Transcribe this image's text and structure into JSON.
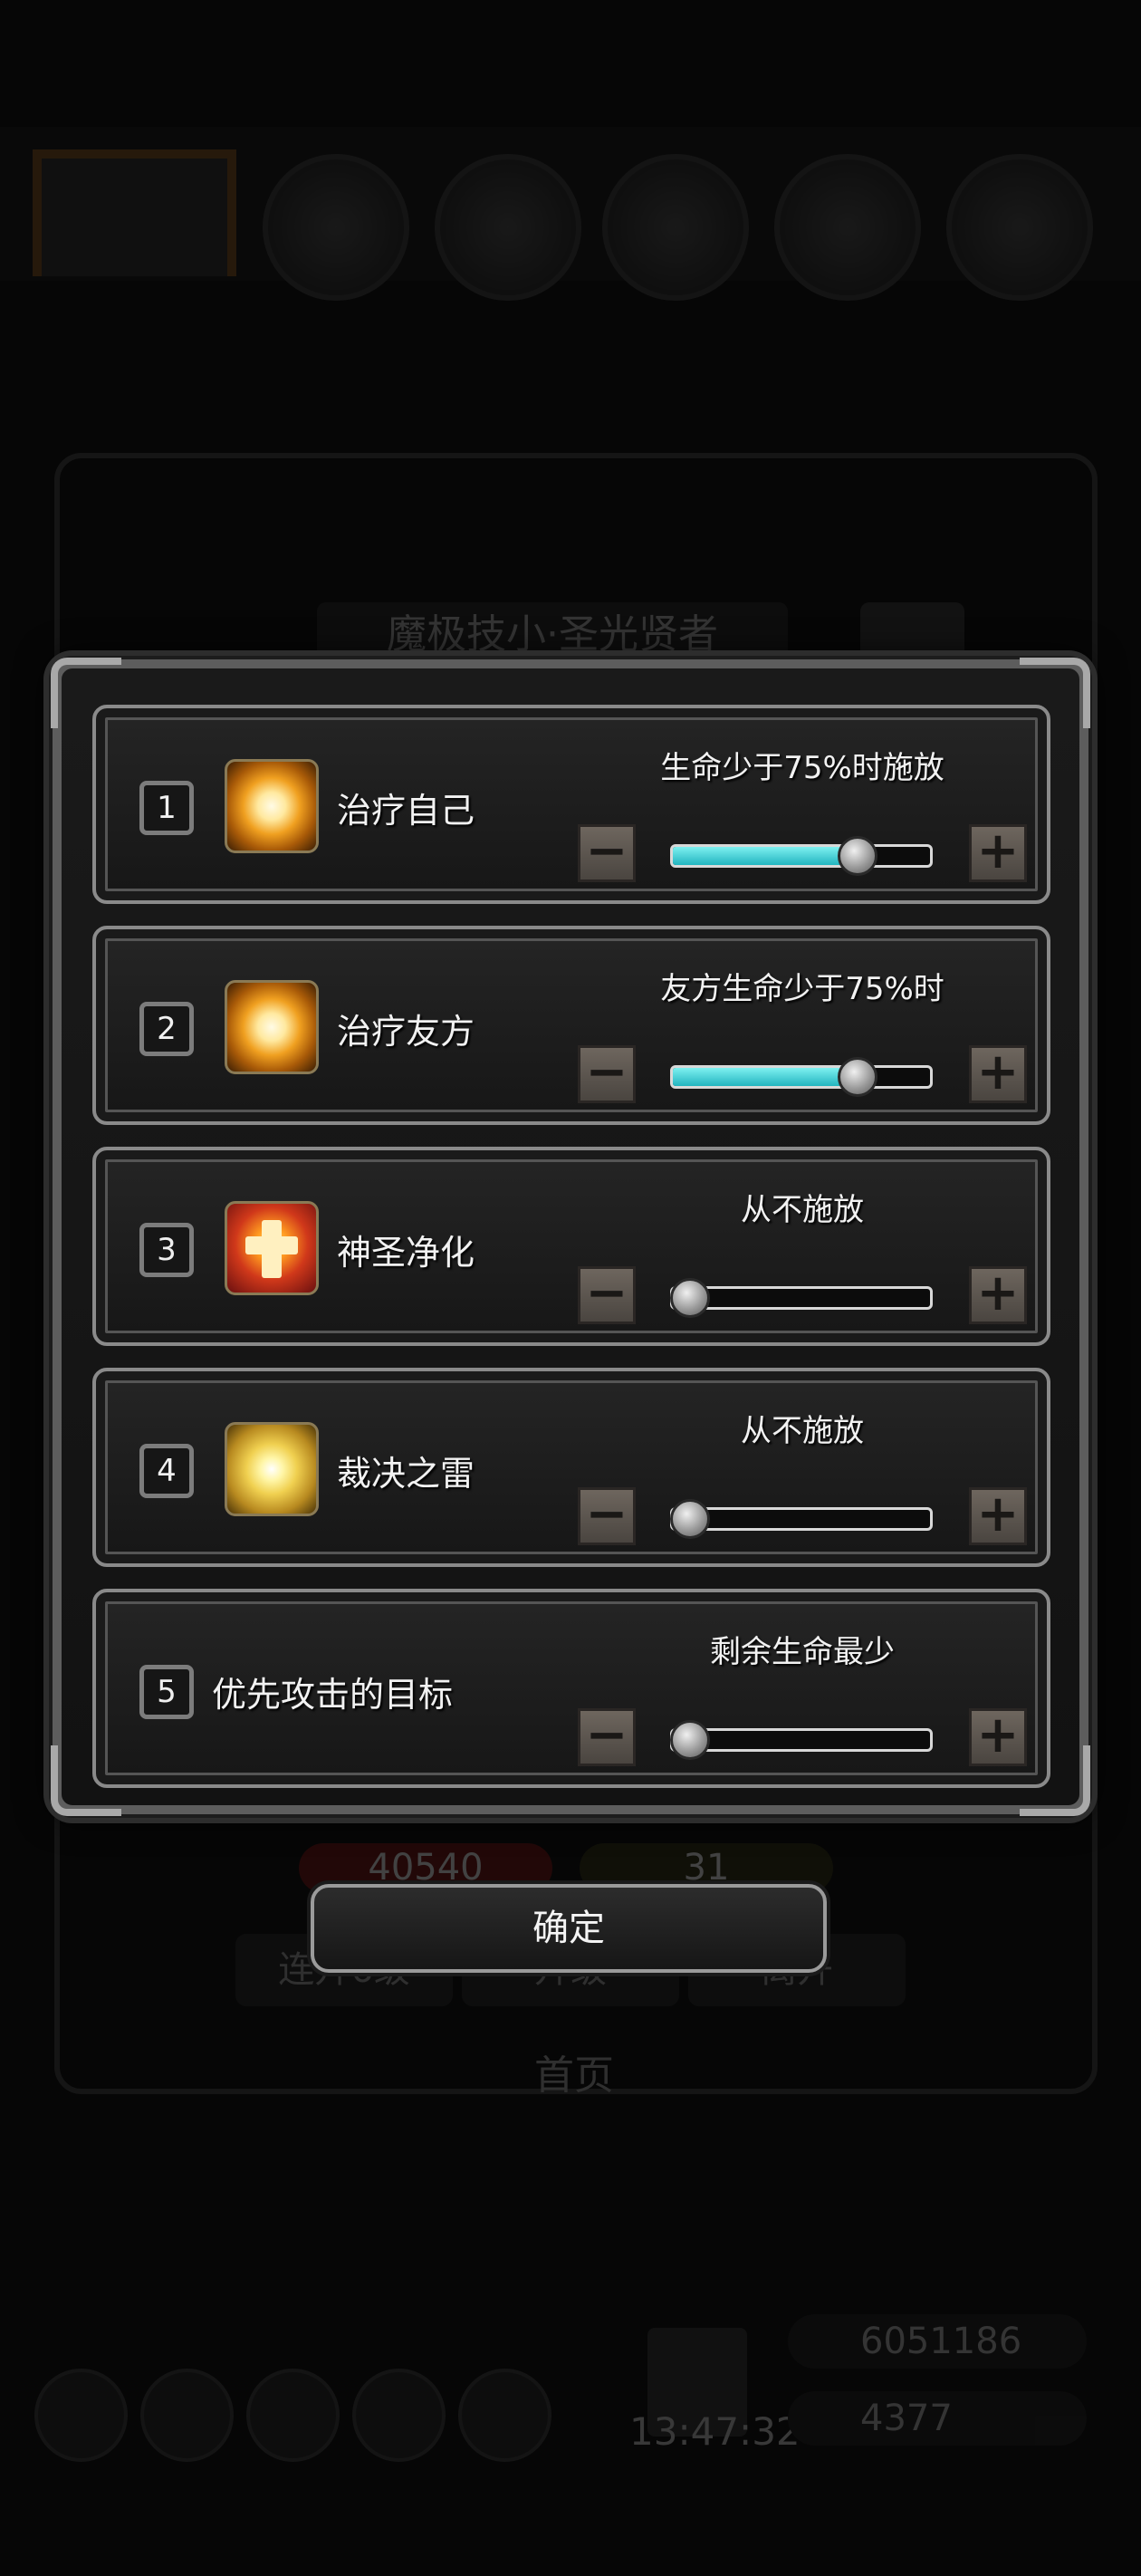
{
  "background": {
    "title": "魔极技小·圣光贤者",
    "stat_red": "40540",
    "stat_energy": "31",
    "buttons": [
      "连升6级",
      "升级",
      "离开"
    ],
    "tab": "首页",
    "gold": "6051186",
    "gems": "4377",
    "clock": "13:47:32"
  },
  "rows": [
    {
      "index": "1",
      "name": "治疗自己",
      "icon": "holy-light-icon",
      "condition": "生命少于75%时施放",
      "slider": 0.75
    },
    {
      "index": "2",
      "name": "治疗友方",
      "icon": "holy-light-icon",
      "condition": "友方生命少于75%时",
      "slider": 0.75
    },
    {
      "index": "3",
      "name": "神圣净化",
      "icon": "holy-purify-icon",
      "condition": "从不施放",
      "slider": 0
    },
    {
      "index": "4",
      "name": "裁决之雷",
      "icon": "judgement-thunder-icon",
      "condition": "从不施放",
      "slider": 0
    },
    {
      "index": "5",
      "name": "优先攻击的目标",
      "icon": "",
      "condition": "剩余生命最少",
      "slider": 0
    }
  ],
  "confirm_label": "确定",
  "colors": {
    "slider_fill": "#3ec8d0",
    "panel": "#161616",
    "frame": "#8a8a8a"
  }
}
